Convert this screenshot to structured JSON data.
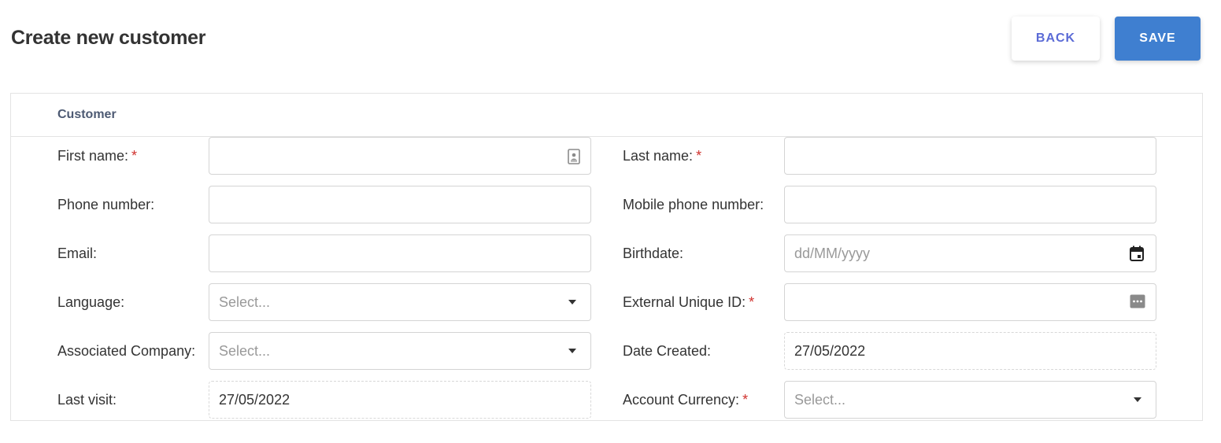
{
  "header": {
    "title": "Create new customer",
    "back_label": "BACK",
    "save_label": "SAVE"
  },
  "card": {
    "title": "Customer"
  },
  "form": {
    "left": [
      {
        "label": "First name:",
        "required": true,
        "type": "text",
        "value": "",
        "icon": "contact-card-icon"
      },
      {
        "label": "Phone number:",
        "required": false,
        "type": "text",
        "value": ""
      },
      {
        "label": "Email:",
        "required": false,
        "type": "text",
        "value": ""
      },
      {
        "label": "Language:",
        "required": false,
        "type": "select",
        "placeholder": "Select..."
      },
      {
        "label": "Associated Company:",
        "required": false,
        "type": "select",
        "placeholder": "Select..."
      },
      {
        "label": "Last visit:",
        "required": false,
        "type": "readonly",
        "value": "27/05/2022"
      }
    ],
    "right": [
      {
        "label": "Last name:",
        "required": true,
        "type": "text",
        "value": ""
      },
      {
        "label": "Mobile phone number:",
        "required": false,
        "type": "text",
        "value": ""
      },
      {
        "label": "Birthdate:",
        "required": false,
        "type": "date",
        "placeholder": "dd/MM/yyyy",
        "icon": "calendar-icon"
      },
      {
        "label": "External Unique ID:",
        "required": true,
        "type": "text",
        "value": "",
        "icon": "password-dots-icon"
      },
      {
        "label": "Date Created:",
        "required": false,
        "type": "readonly",
        "value": "27/05/2022"
      },
      {
        "label": "Account Currency:",
        "required": true,
        "type": "select",
        "placeholder": "Select..."
      }
    ],
    "required_marker": "*"
  },
  "colors": {
    "accent": "#3f7fd0",
    "back_text": "#5b6bd6",
    "required": "#d0312d",
    "section_title": "#4d5a73"
  }
}
